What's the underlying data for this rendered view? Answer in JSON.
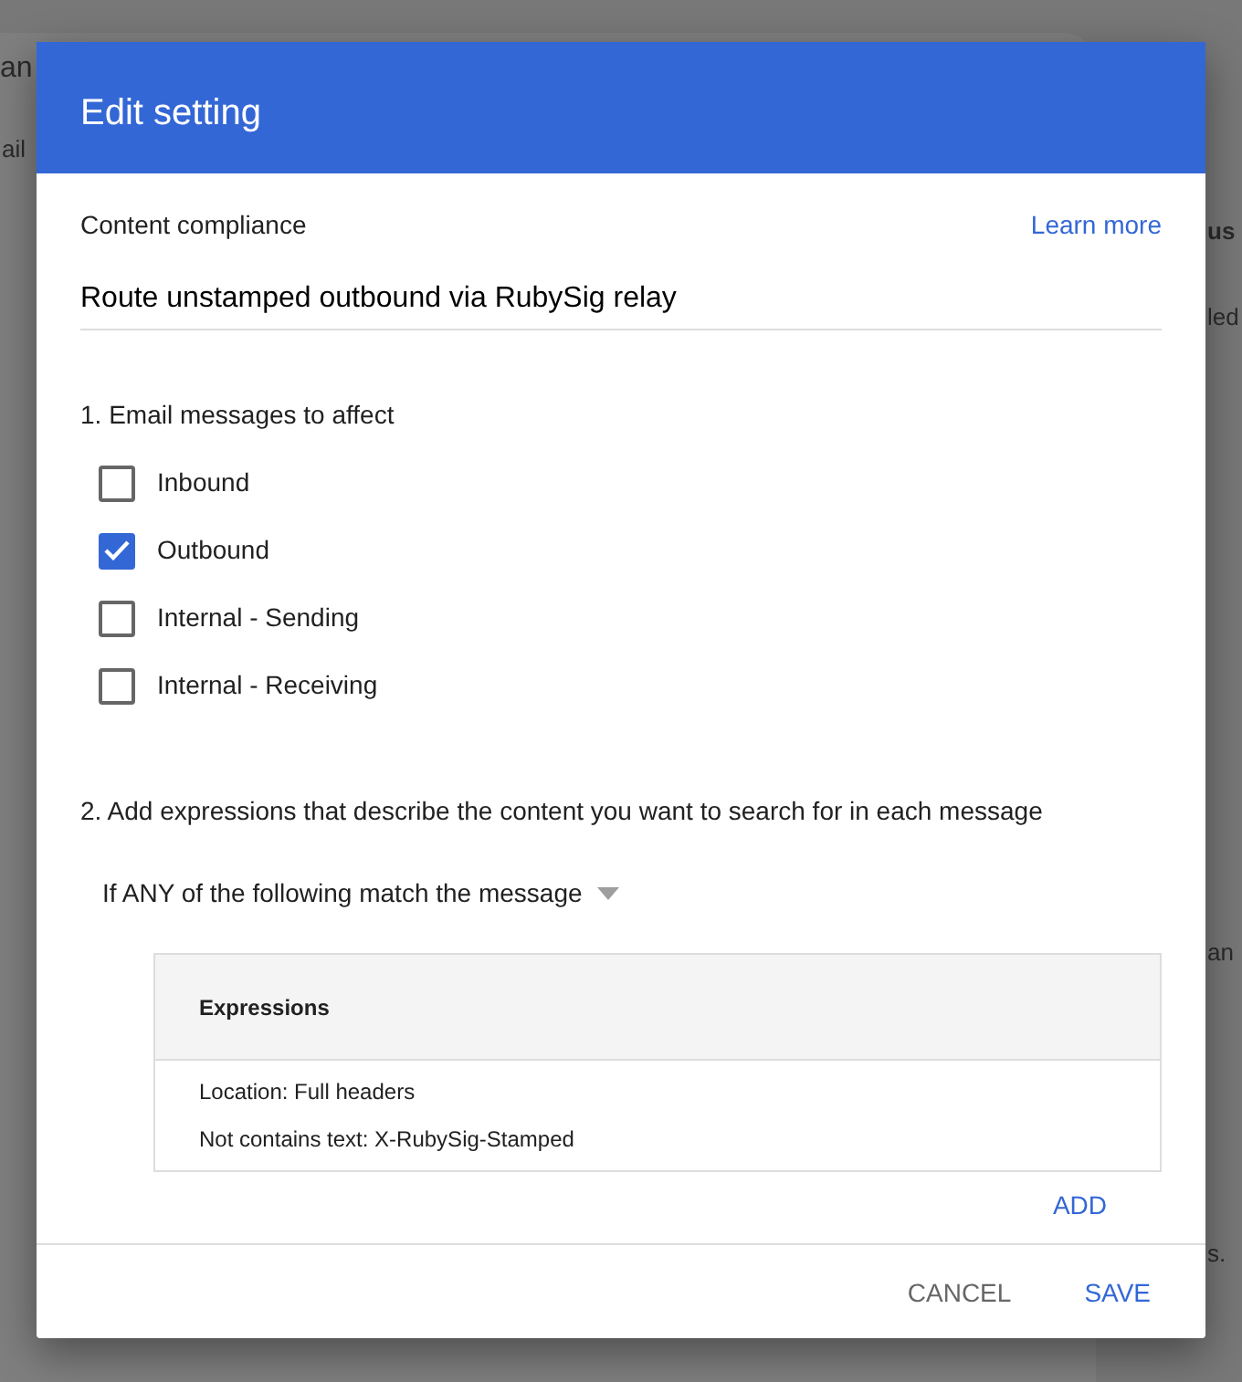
{
  "background": {
    "fragments": [
      {
        "text": "an",
        "kind": "title"
      },
      {
        "text": "ail",
        "kind": "tab"
      },
      {
        "text": "us",
        "kind": "heading"
      },
      {
        "text": "led",
        "kind": "cell"
      },
      {
        "text": "an",
        "kind": "text"
      },
      {
        "text": "s.",
        "kind": "text"
      }
    ]
  },
  "dialog": {
    "title": "Edit setting",
    "setting_type": "Content compliance",
    "learn_more": "Learn more",
    "name_value": "Route unstamped outbound via RubySig relay",
    "section_1": "1. Email messages to affect",
    "checkboxes": [
      {
        "label": "Inbound",
        "checked": false
      },
      {
        "label": "Outbound",
        "checked": true
      },
      {
        "label": "Internal - Sending",
        "checked": false
      },
      {
        "label": "Internal - Receiving",
        "checked": false
      }
    ],
    "section_2": "2. Add expressions that describe the content you want to search for in each message",
    "match_dropdown": "If ANY of the following match the message",
    "expressions": {
      "header": "Expressions",
      "lines": [
        "Location: Full headers",
        "Not contains text: X-RubySig-Stamped"
      ]
    },
    "add_button": "ADD",
    "buttons": [
      {
        "label": "CANCEL",
        "kind": "secondary"
      },
      {
        "label": "SAVE",
        "kind": "primary"
      }
    ]
  }
}
